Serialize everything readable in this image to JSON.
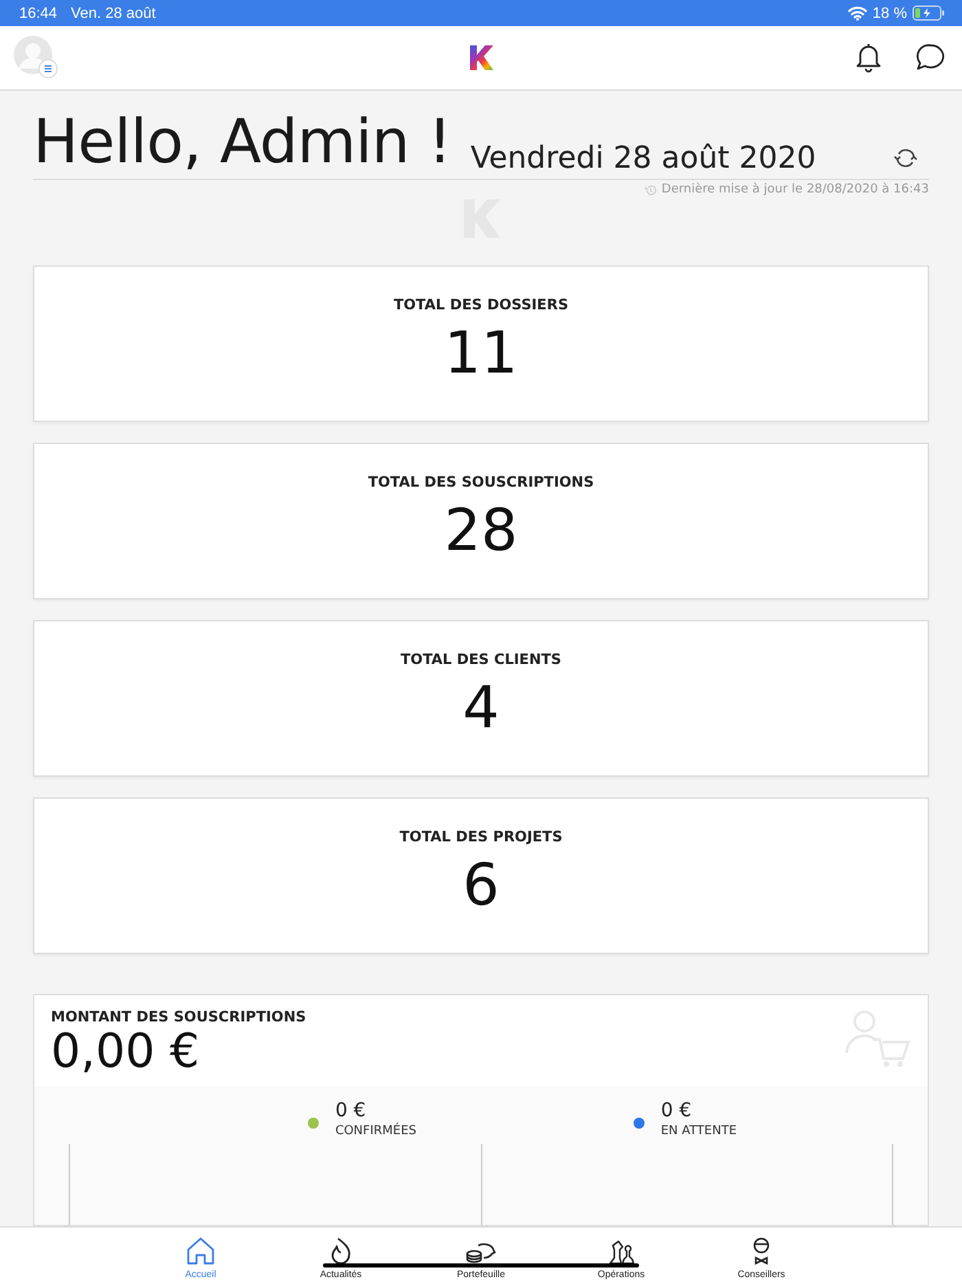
{
  "status_bar": {
    "time": "16:44",
    "date": "Ven. 28 août",
    "battery": "18 %"
  },
  "greeting": {
    "title": "Hello, Admin !",
    "date": "Vendredi 28 août 2020",
    "last_update": "Dernière mise à jour le 28/08/2020 à 16:43"
  },
  "stats": [
    {
      "label": "TOTAL DES DOSSIERS",
      "value": "11"
    },
    {
      "label": "TOTAL DES SOUSCRIPTIONS",
      "value": "28"
    },
    {
      "label": "TOTAL DES CLIENTS",
      "value": "4"
    },
    {
      "label": "TOTAL DES PROJETS",
      "value": "6"
    }
  ],
  "amount": {
    "title": "MONTANT DES SOUSCRIPTIONS",
    "value": "0,00 €",
    "legend": [
      {
        "value": "0 €",
        "label": "CONFIRMÉES",
        "color": "#9bc34a"
      },
      {
        "value": "0 €",
        "label": "EN ATTENTE",
        "color": "#2f78e8"
      }
    ]
  },
  "tab_bar": [
    {
      "label": "Accueil",
      "kind": "home",
      "selected": true
    },
    {
      "label": "Actualités",
      "kind": "flame",
      "selected": false
    },
    {
      "label": "Portefeuille",
      "kind": "piggy",
      "selected": false
    },
    {
      "label": "Opérations",
      "kind": "chess",
      "selected": false
    },
    {
      "label": "Conseillers",
      "kind": "advisor",
      "selected": false
    }
  ]
}
